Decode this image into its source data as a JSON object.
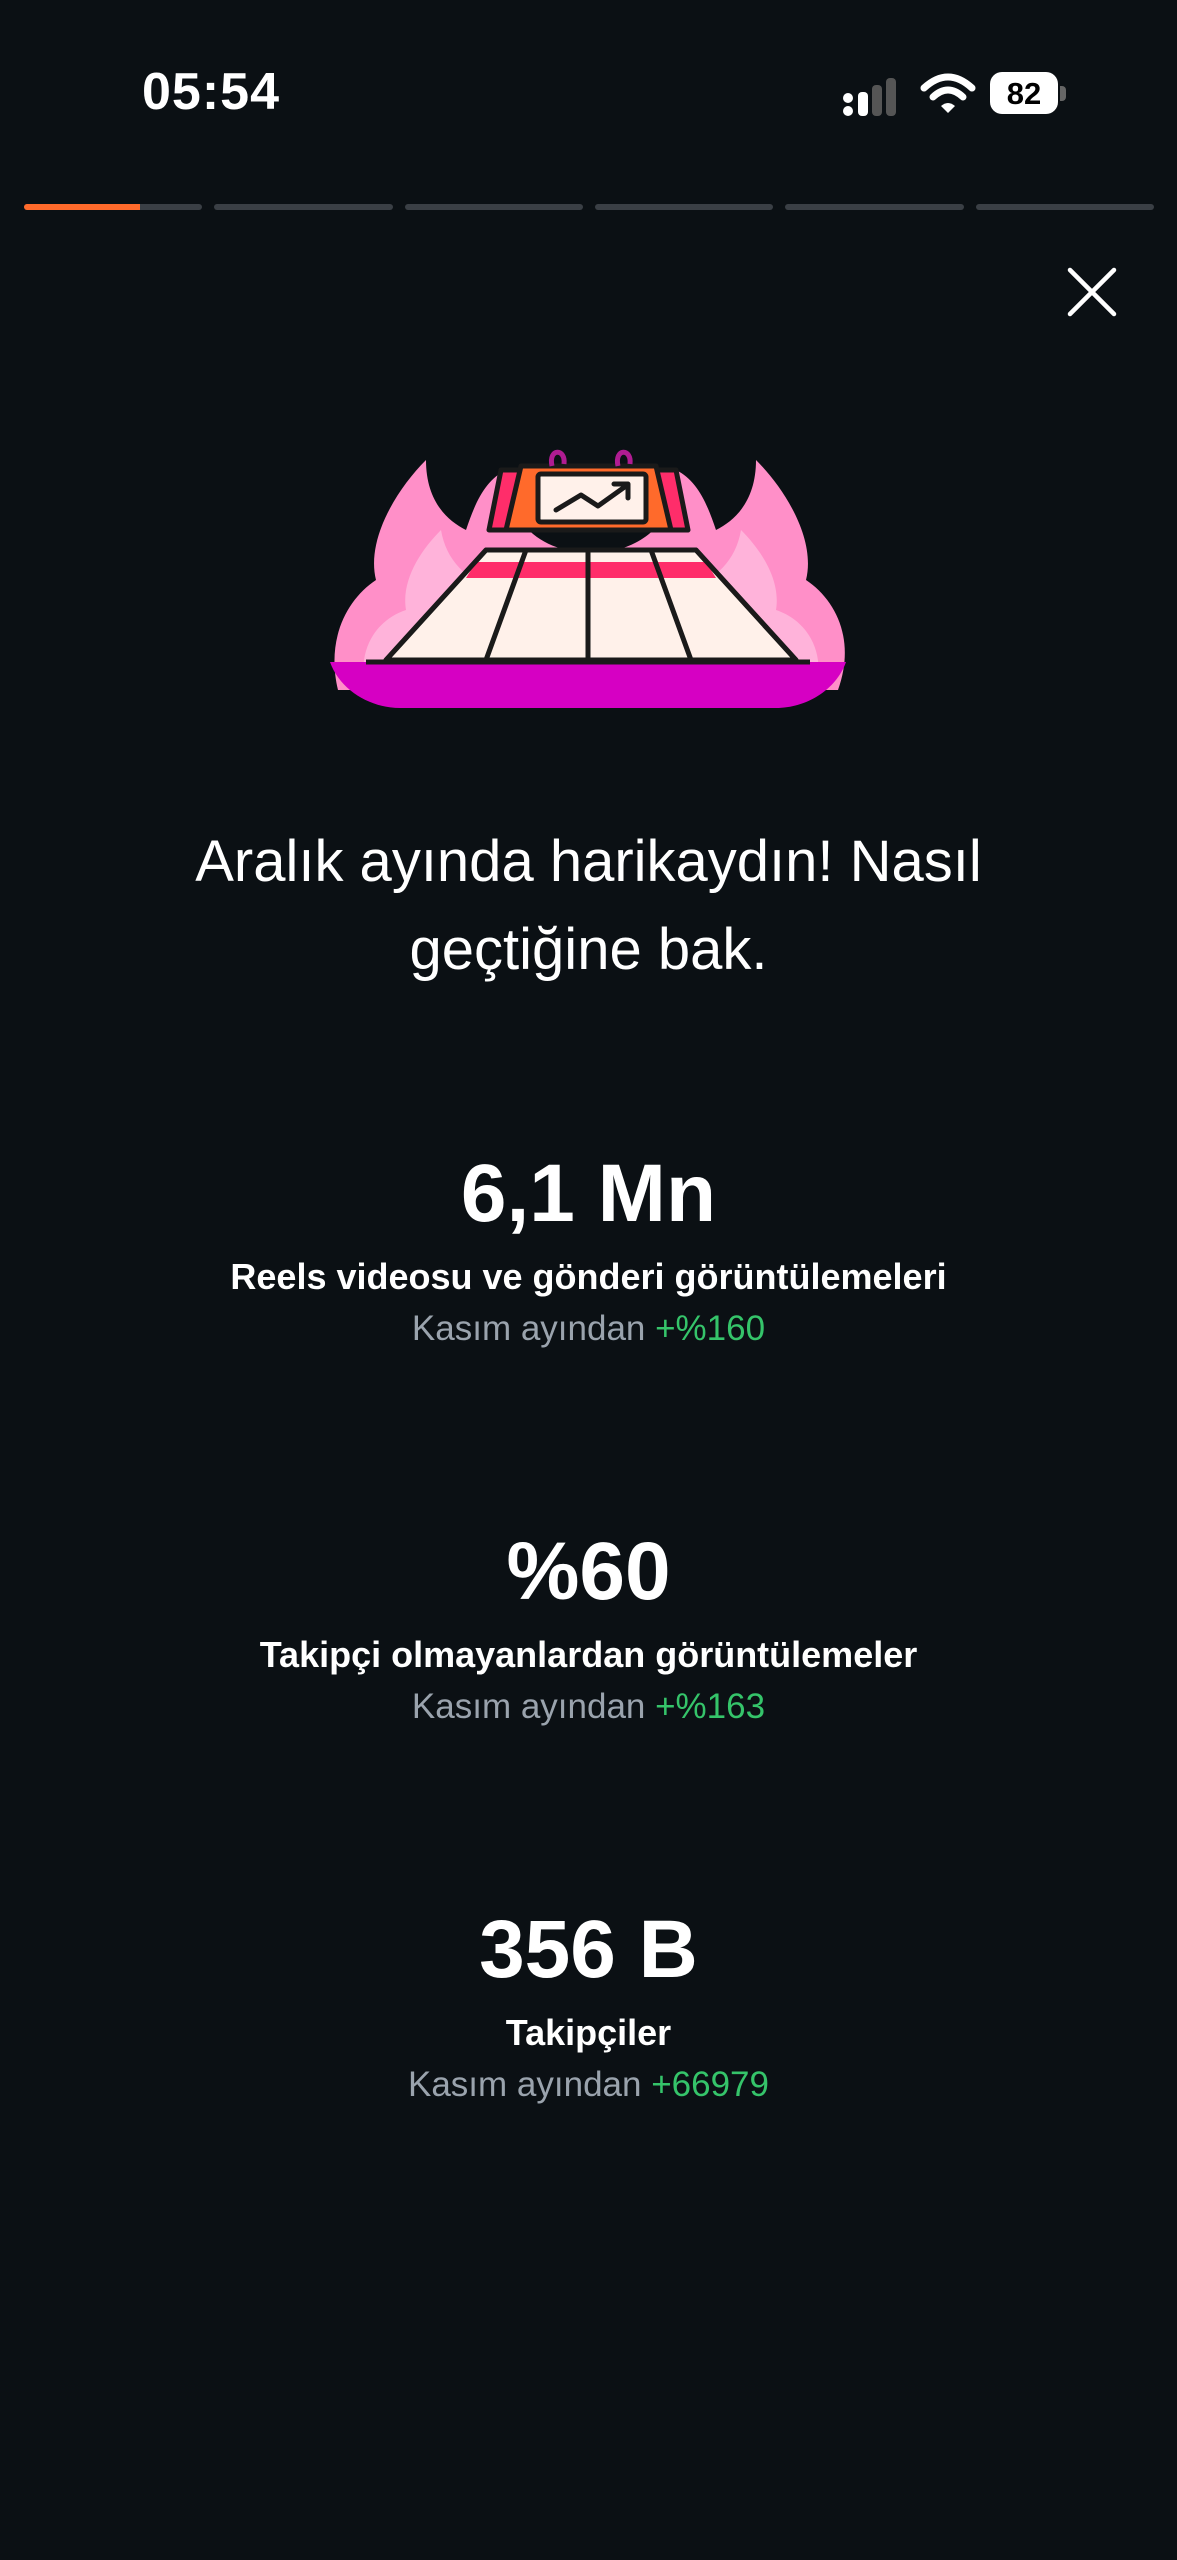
{
  "status_bar": {
    "time": "05:54",
    "battery": "82"
  },
  "story_progress": {
    "segments": 6,
    "current_segment": 1,
    "current_fill": 0.65
  },
  "close_icon": "close-icon",
  "illustration": "flaming-trending-calendar-illustration",
  "headline": "Aralık ayında harikaydın! Nasıl geçtiğine bak.",
  "stats": [
    {
      "value": "6,1 Mn",
      "label": "Reels videosu ve gönderi görüntülemeleri",
      "compare": "Kasım ayından",
      "delta": "+%160"
    },
    {
      "value": "%60",
      "label": "Takipçi olmayanlardan görüntülemeler",
      "compare": "Kasım ayından",
      "delta": "+%163"
    },
    {
      "value": "356 B",
      "label": "Takipçiler",
      "compare": "Kasım ayından",
      "delta": "+66979"
    }
  ],
  "colors": {
    "background": "#0b1014",
    "accent": "#ff6a2b",
    "positive": "#35c46a",
    "muted": "#9aa3ad"
  }
}
